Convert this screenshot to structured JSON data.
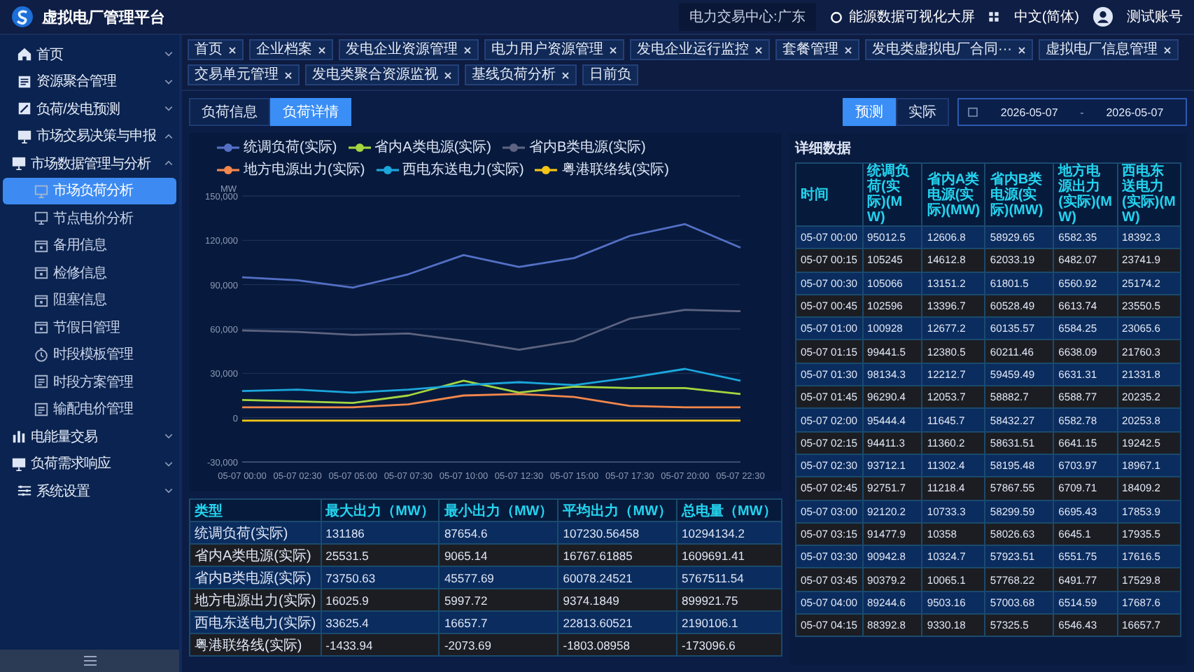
{
  "header": {
    "title": "虚拟电厂管理平台",
    "region": "电力交易中心:广东",
    "dashboard_link": "能源数据可视化大屏",
    "language": "中文(简体)",
    "user": "测试账号"
  },
  "tabs": [
    {
      "label": "首页",
      "closable": true
    },
    {
      "label": "企业档案",
      "closable": true
    },
    {
      "label": "发电企业资源管理",
      "closable": true
    },
    {
      "label": "电力用户资源管理",
      "closable": true
    },
    {
      "label": "发电企业运行监控",
      "closable": true
    },
    {
      "label": "套餐管理",
      "closable": true
    },
    {
      "label": "发电类虚拟电厂合同···",
      "closable": true
    },
    {
      "label": "虚拟电厂信息管理",
      "closable": true
    },
    {
      "label": "交易单元管理",
      "closable": true
    },
    {
      "label": "发电类聚合资源监视",
      "closable": true
    },
    {
      "label": "基线负荷分析",
      "closable": true
    },
    {
      "label": "日前负",
      "closable": false
    }
  ],
  "sidebar": {
    "items": [
      {
        "label": "首页",
        "expanded": false,
        "selected": false
      },
      {
        "label": "资源聚合管理",
        "expanded": false,
        "selected": false
      },
      {
        "label": "负荷/发电预测",
        "expanded": false,
        "selected": false
      },
      {
        "label": "市场交易决策与申报",
        "expanded": true,
        "selected": false,
        "children": [
          {
            "label": "市场数据管理与分析",
            "expanded": true,
            "selected": false,
            "children": [
              {
                "label": "市场负荷分析",
                "selected": true
              },
              {
                "label": "节点电价分析",
                "selected": false
              },
              {
                "label": "备用信息",
                "selected": false
              },
              {
                "label": "检修信息",
                "selected": false
              },
              {
                "label": "阻塞信息",
                "selected": false
              },
              {
                "label": "节假日管理",
                "selected": false
              },
              {
                "label": "时段模板管理",
                "selected": false
              },
              {
                "label": "时段方案管理",
                "selected": false
              },
              {
                "label": "输配电价管理",
                "selected": false
              }
            ]
          },
          {
            "label": "电能量交易",
            "expanded": false,
            "selected": false
          },
          {
            "label": "负荷需求响应",
            "expanded": false,
            "selected": false
          }
        ]
      },
      {
        "label": "系统设置",
        "expanded": false,
        "selected": false
      }
    ]
  },
  "view_toggle": [
    {
      "label": "负荷信息",
      "selected": false
    },
    {
      "label": "负荷详情",
      "selected": true
    }
  ],
  "data_toggle": [
    {
      "label": "预测",
      "selected": true
    },
    {
      "label": "实际",
      "selected": false
    }
  ],
  "date_range": {
    "start": "2026-05-07",
    "separator": "-",
    "end": "2026-05-07"
  },
  "chart": {
    "chart_data": {
      "type": "line",
      "ylabel": "MW",
      "categories": [
        "05-07 00:00",
        "05-07 02:30",
        "05-07 05:00",
        "05-07 07:30",
        "05-07 10:00",
        "05-07 12:30",
        "05-07 15:00",
        "05-07 17:30",
        "05-07 20:00",
        "05-07 22:30"
      ],
      "series": [
        {
          "name": "统调负荷(实际)",
          "color": "#5470c6",
          "values": [
            95000,
            93000,
            88000,
            97000,
            110000,
            102000,
            108000,
            123000,
            131000,
            115000
          ]
        },
        {
          "name": "省内A类电源(实际)",
          "color": "#a5d63f",
          "values": [
            12000,
            11000,
            10000,
            15000,
            25000,
            17000,
            21000,
            20000,
            20000,
            16000
          ]
        },
        {
          "name": "省内B类电源(实际)",
          "color": "#5d6380",
          "values": [
            59000,
            58000,
            56000,
            57000,
            52000,
            46000,
            52000,
            67000,
            73000,
            72000
          ]
        },
        {
          "name": "地方电源出力(实际)",
          "color": "#f4874b",
          "values": [
            7000,
            7000,
            7000,
            9000,
            15000,
            16000,
            14000,
            8000,
            7000,
            7000
          ]
        },
        {
          "name": "西电东送电力(实际)",
          "color": "#1ba7dc",
          "values": [
            18000,
            19000,
            17000,
            19000,
            22000,
            24000,
            22000,
            27000,
            33000,
            25000
          ]
        },
        {
          "name": "粤港联络线(实际)",
          "color": "#f5c518",
          "values": [
            -2000,
            -2000,
            -2000,
            -2000,
            -2000,
            -2000,
            -2000,
            -2000,
            -2000,
            -2000
          ]
        }
      ],
      "grid": true,
      "legend": true,
      "ylim": [
        -30000,
        150000
      ],
      "yticks": [
        {
          "value": -30000,
          "label": "-30,000"
        },
        {
          "value": 0,
          "label": "0"
        },
        {
          "value": 30000,
          "label": "30,000"
        },
        {
          "value": 60000,
          "label": "60,000"
        },
        {
          "value": 90000,
          "label": "90,000"
        },
        {
          "value": 120000,
          "label": "120,000"
        },
        {
          "value": 150000,
          "label": "150,000"
        }
      ]
    }
  },
  "summary_table": {
    "columns": [
      "类型",
      "最大出力（MW）",
      "最小出力（MW）",
      "平均出力（MW）",
      "总电量（MW）"
    ],
    "rows": [
      [
        "统调负荷(实际)",
        "131186",
        "87654.6",
        "107230.56458",
        "10294134.2"
      ],
      [
        "省内A类电源(实际)",
        "25531.5",
        "9065.14",
        "16767.61885",
        "1609691.41"
      ],
      [
        "省内B类电源(实际)",
        "73750.63",
        "45577.69",
        "60078.24521",
        "5767511.54"
      ],
      [
        "地方电源出力(实际)",
        "16025.9",
        "5997.72",
        "9374.1849",
        "899921.75"
      ],
      [
        "西电东送电力(实际)",
        "33625.4",
        "16657.7",
        "22813.60521",
        "2190106.1"
      ],
      [
        "粤港联络线(实际)",
        "-1433.94",
        "-2073.69",
        "-1803.08958",
        "-173096.6"
      ]
    ]
  },
  "detail_table": {
    "title": "详细数据",
    "columns": [
      "时间",
      "统调负荷(实际)(MW)",
      "省内A类电源(实际)(MW)",
      "省内B类电源(实际)(MW)",
      "地方电源出力(实际)(MW)",
      "西电东送电力(实际)(MW)"
    ],
    "rows": [
      [
        "05-07 00:00",
        "95012.5",
        "12606.8",
        "58929.65",
        "6582.35",
        "18392.3"
      ],
      [
        "05-07 00:15",
        "105245",
        "14612.8",
        "62033.19",
        "6482.07",
        "23741.9"
      ],
      [
        "05-07 00:30",
        "105066",
        "13151.2",
        "61801.5",
        "6560.92",
        "25174.2"
      ],
      [
        "05-07 00:45",
        "102596",
        "13396.7",
        "60528.49",
        "6613.74",
        "23550.5"
      ],
      [
        "05-07 01:00",
        "100928",
        "12677.2",
        "60135.57",
        "6584.25",
        "23065.6"
      ],
      [
        "05-07 01:15",
        "99441.5",
        "12380.5",
        "60211.46",
        "6638.09",
        "21760.3"
      ],
      [
        "05-07 01:30",
        "98134.3",
        "12212.7",
        "59459.49",
        "6631.31",
        "21331.8"
      ],
      [
        "05-07 01:45",
        "96290.4",
        "12053.7",
        "58882.7",
        "6588.77",
        "20235.2"
      ],
      [
        "05-07 02:00",
        "95444.4",
        "11645.7",
        "58432.27",
        "6582.78",
        "20253.8"
      ],
      [
        "05-07 02:15",
        "94411.3",
        "11360.2",
        "58631.51",
        "6641.15",
        "19242.5"
      ],
      [
        "05-07 02:30",
        "93712.1",
        "11302.4",
        "58195.48",
        "6703.97",
        "18967.1"
      ],
      [
        "05-07 02:45",
        "92751.7",
        "11218.4",
        "57867.55",
        "6709.71",
        "18409.2"
      ],
      [
        "05-07 03:00",
        "92120.2",
        "10733.3",
        "58299.59",
        "6695.43",
        "17853.9"
      ],
      [
        "05-07 03:15",
        "91477.9",
        "10358",
        "58026.63",
        "6645.1",
        "17935.5"
      ],
      [
        "05-07 03:30",
        "90942.8",
        "10324.7",
        "57923.51",
        "6551.75",
        "17616.5"
      ],
      [
        "05-07 03:45",
        "90379.2",
        "10065.1",
        "57768.22",
        "6491.77",
        "17529.8"
      ],
      [
        "05-07 04:00",
        "89244.6",
        "9503.16",
        "57003.68",
        "6514.59",
        "17687.6"
      ],
      [
        "05-07 04:15",
        "88392.8",
        "9330.18",
        "57325.5",
        "6546.43",
        "16657.7"
      ]
    ]
  }
}
